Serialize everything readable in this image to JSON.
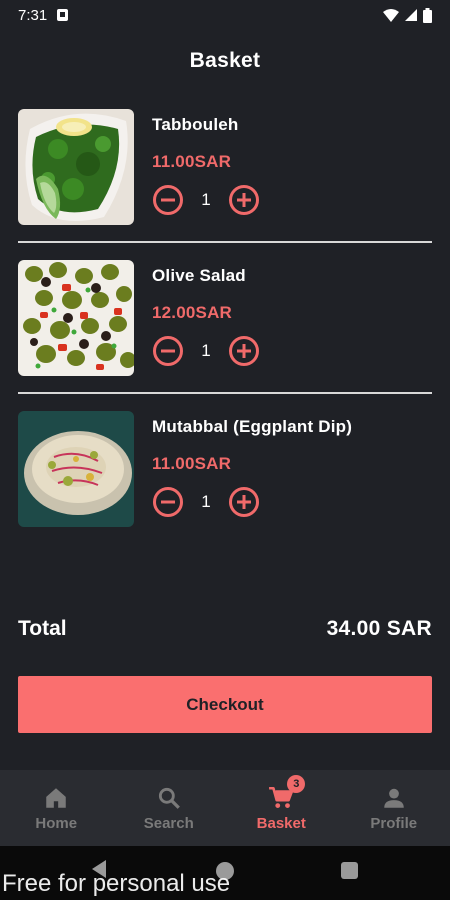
{
  "status_bar": {
    "time": "7:31"
  },
  "header": {
    "title": "Basket"
  },
  "items": [
    {
      "name": "Tabbouleh",
      "price": "11.00SAR",
      "quantity": "1"
    },
    {
      "name": "Olive Salad",
      "price": "12.00SAR",
      "quantity": "1"
    },
    {
      "name": "Mutabbal (Eggplant Dip)",
      "price": "11.00SAR",
      "quantity": "1"
    }
  ],
  "summary": {
    "total_label": "Total",
    "total_value": "34.00 SAR"
  },
  "checkout": {
    "label": "Checkout"
  },
  "bottom_nav": {
    "items": [
      {
        "label": "Home",
        "icon": "home-icon"
      },
      {
        "label": "Search",
        "icon": "search-icon"
      },
      {
        "label": "Basket",
        "icon": "cart-icon",
        "badge": "3",
        "active": true
      },
      {
        "label": "Profile",
        "icon": "person-icon"
      }
    ]
  },
  "watermark": "Free for personal use",
  "colors": {
    "background": "#1f2126",
    "accent": "#f06a6a",
    "button": "#fa6f6f",
    "nav_background": "#2a2c31",
    "inactive": "#7a7a7a"
  }
}
